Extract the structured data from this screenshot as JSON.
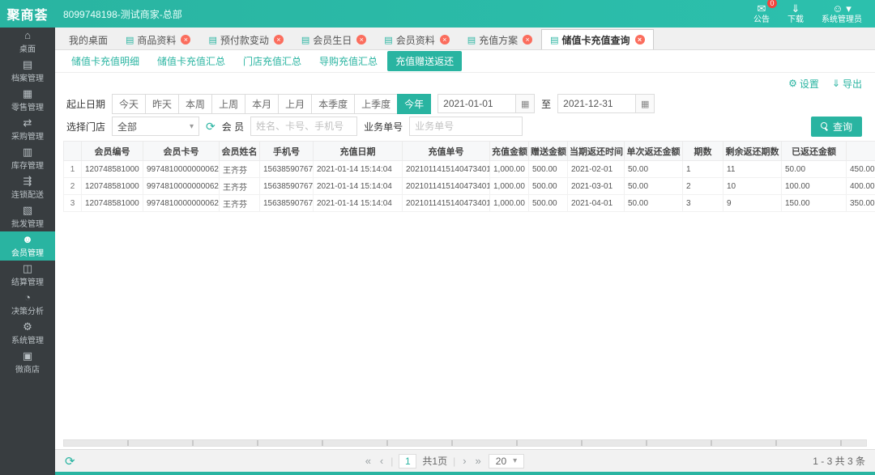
{
  "theme": {
    "primary": "#29b4a1",
    "sidebar_bg": "#383d40",
    "danger": "#f4433c"
  },
  "header": {
    "logo": "聚商荟",
    "account": "8099748198-测试商家-总部",
    "notice_label": "公告",
    "notice_badge": "0",
    "download_label": "下载",
    "admin_label": "系统管理员"
  },
  "sidebar": {
    "items": [
      {
        "name": "desktop",
        "label": "桌面",
        "glyph": "⌂",
        "active": false
      },
      {
        "name": "archives",
        "label": "档案管理",
        "glyph": "▤",
        "active": false
      },
      {
        "name": "retail",
        "label": "零售管理",
        "glyph": "▦",
        "active": false
      },
      {
        "name": "purchase",
        "label": "采购管理",
        "glyph": "⇄",
        "active": false
      },
      {
        "name": "inventory",
        "label": "库存管理",
        "glyph": "▥",
        "active": false
      },
      {
        "name": "chain-delivery",
        "label": "连锁配送",
        "glyph": "⇶",
        "active": false
      },
      {
        "name": "wholesale",
        "label": "批发管理",
        "glyph": "▧",
        "active": false
      },
      {
        "name": "member",
        "label": "会员管理",
        "glyph": "☻",
        "active": true
      },
      {
        "name": "settlement",
        "label": "结算管理",
        "glyph": "◫",
        "active": false
      },
      {
        "name": "analytics",
        "label": "决策分析",
        "glyph": "◔",
        "active": false
      },
      {
        "name": "system",
        "label": "系统管理",
        "glyph": "⚙",
        "active": false
      },
      {
        "name": "micro-store",
        "label": "微商店",
        "glyph": "▣",
        "active": false
      }
    ]
  },
  "tabbar": {
    "tabs": [
      {
        "label": "我的桌面",
        "closable": false,
        "active": false,
        "icon": false
      },
      {
        "label": "商品资料",
        "closable": true,
        "active": false,
        "icon": true
      },
      {
        "label": "预付款变动",
        "closable": true,
        "active": false,
        "icon": true
      },
      {
        "label": "会员生日",
        "closable": true,
        "active": false,
        "icon": true
      },
      {
        "label": "会员资料",
        "closable": true,
        "active": false,
        "icon": true
      },
      {
        "label": "充值方案",
        "closable": true,
        "active": false,
        "icon": true
      },
      {
        "label": "储值卡充值查询",
        "closable": true,
        "active": true,
        "icon": true
      }
    ]
  },
  "subtabs": {
    "items": [
      {
        "label": "储值卡充值明细",
        "active": false
      },
      {
        "label": "储值卡充值汇总",
        "active": false
      },
      {
        "label": "门店充值汇总",
        "active": false
      },
      {
        "label": "导购充值汇总",
        "active": false
      },
      {
        "label": "充值赠送返还",
        "active": true
      }
    ]
  },
  "toolbar": {
    "settings_label": "设置",
    "export_label": "导出"
  },
  "filters": {
    "date_label": "起止日期",
    "quick_ranges": [
      "今天",
      "昨天",
      "本周",
      "上周",
      "本月",
      "上月",
      "本季度",
      "上季度",
      "今年"
    ],
    "active_range": "今年",
    "date_from": "2021-01-01",
    "to_label": "至",
    "date_to": "2021-12-31",
    "store_label": "选择门店",
    "store_value": "全部",
    "member_label": "会 员",
    "member_placeholder": "姓名、卡号、手机号",
    "order_label": "业务单号",
    "order_placeholder": "业务单号",
    "search_label": "查询"
  },
  "table": {
    "columns": [
      "",
      "会员编号",
      "会员卡号",
      "会员姓名",
      "手机号",
      "充值日期",
      "充值单号",
      "充值金额",
      "赠送金额",
      "当期返还时间",
      "单次返还金额",
      "期数",
      "剩余返还期数",
      "已返还金额",
      ""
    ],
    "rows": [
      [
        "1",
        "120748581000",
        "9974810000000062",
        "王齐芬",
        "15638590767",
        "2021-01-14 15:14:04",
        "2021011415140473401",
        "1,000.00",
        "500.00",
        "2021-02-01",
        "50.00",
        "1",
        "11",
        "50.00",
        "450.00"
      ],
      [
        "2",
        "120748581000",
        "9974810000000062",
        "王齐芬",
        "15638590767",
        "2021-01-14 15:14:04",
        "2021011415140473401",
        "1,000.00",
        "500.00",
        "2021-03-01",
        "50.00",
        "2",
        "10",
        "100.00",
        "400.00"
      ],
      [
        "3",
        "120748581000",
        "9974810000000062",
        "王齐芬",
        "15638590767",
        "2021-01-14 15:14:04",
        "2021011415140473401",
        "1,000.00",
        "500.00",
        "2021-04-01",
        "50.00",
        "3",
        "9",
        "150.00",
        "350.00"
      ]
    ]
  },
  "pagination": {
    "first": "«",
    "prev": "‹",
    "page": "1",
    "pages_label": "共1页",
    "next": "›",
    "last": "»",
    "page_size": "20",
    "summary": "1 - 3  共 3 条"
  }
}
